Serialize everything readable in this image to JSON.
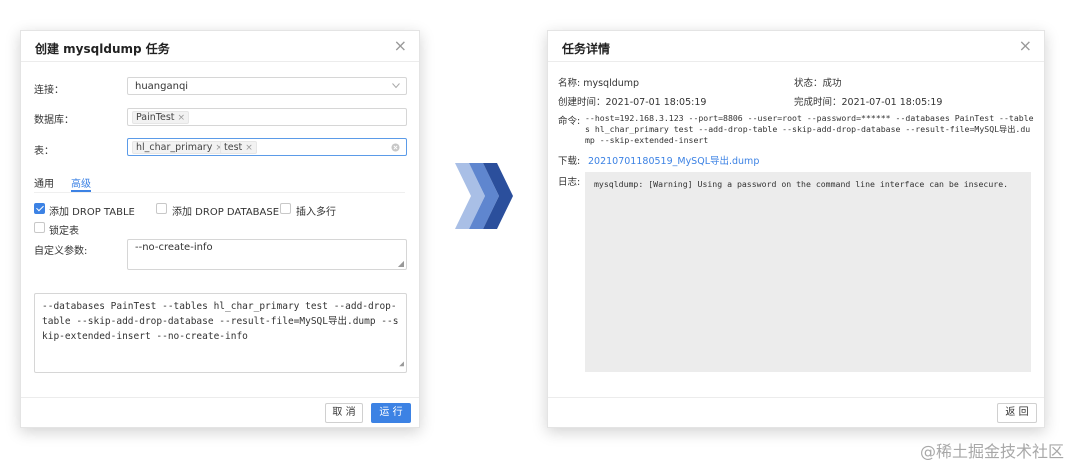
{
  "create_dialog": {
    "title": "创建 mysqldump 任务",
    "close_glyph": "×",
    "connection": {
      "label": "连接：",
      "value": "huanganqi"
    },
    "database": {
      "label": "数据库：",
      "tag": "PainTest"
    },
    "table": {
      "label": "表：",
      "tags": [
        "hl_char_primary",
        "test"
      ]
    },
    "tabs": [
      "通用",
      "高级"
    ],
    "options": {
      "add_drop_table": "添加 DROP TABLE",
      "add_drop_database": "添加 DROP DATABASE",
      "insert_multi_rows": "插入多行",
      "lock_tables": "锁定表"
    },
    "custom_params": {
      "label": "自定义参数:",
      "value": "--no-create-info"
    },
    "command_preview": "--databases PainTest --tables hl_char_primary test --add-drop-table --skip-add-drop-database --result-file=MySQL导出.dump --skip-extended-insert --no-create-info",
    "cancel_label": "取 消",
    "run_label": "运 行",
    "tag_remove_glyph": "×"
  },
  "detail_dialog": {
    "title": "任务详情",
    "close_glyph": "×",
    "name_label": "名称:",
    "name_value": "mysqldump",
    "status_label": "状态：",
    "status_value": "成功",
    "created_label": "创建时间：",
    "created_value": "2021-07-01 18:05:19",
    "completed_label": "完成时间：",
    "completed_value": "2021-07-01 18:05:19",
    "command_label": "命令:",
    "command_value": "--host=192.168.3.123 --port=8806 --user=root --password=****** --databases PainTest --tables hl_char_primary test --add-drop-table --skip-add-drop-database --result-file=MySQL导出.dump --skip-extended-insert",
    "download_label": "下载:",
    "download_link": "20210701180519_MySQL导出.dump",
    "log_label": "日志:",
    "log_text": "mysqldump: [Warning] Using a password on the command line interface can be insecure.",
    "back_label": "返 回"
  },
  "watermark": "@稀土掘金技术社区",
  "colors": {
    "accent": "#3c82e4",
    "arrow_light": "#a9bfe6",
    "arrow_mid": "#5f86cf",
    "arrow_dark": "#2b4f9c",
    "log_bg": "#ececec"
  },
  "icons": {
    "dropdown": "chevron-down-icon",
    "clear": "clear-circle-icon",
    "close": "close-icon",
    "arrows": "triple-chevron-arrow-icon"
  }
}
